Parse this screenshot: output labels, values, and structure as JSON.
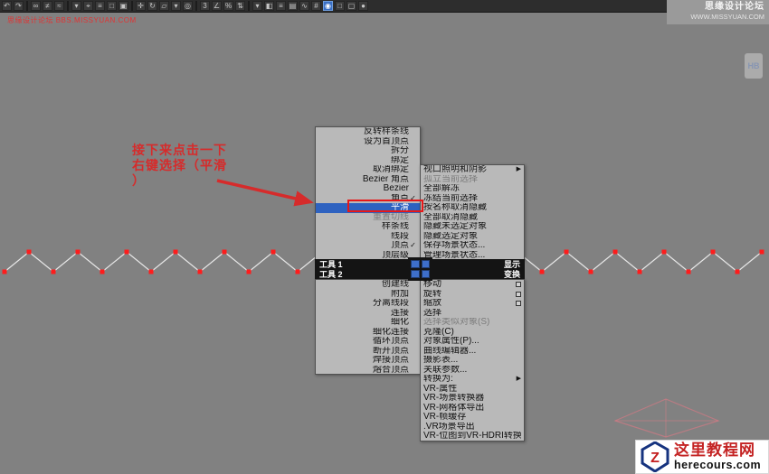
{
  "watermarks": {
    "top_right_line1": "思缘设计论坛",
    "top_right_line2": "WWW.MISSYUAN.COM",
    "top_left_red": "思缘设计论坛 BBS.MISSYUAN.COM",
    "badge": "HB"
  },
  "icons": {
    "submenu": "▶",
    "check": "✓"
  },
  "toolbar": {
    "icons": [
      {
        "name": "undo-icon",
        "glyph": "↶"
      },
      {
        "name": "redo-icon",
        "glyph": "↷"
      },
      {
        "sep": true
      },
      {
        "name": "select-and-link-icon",
        "glyph": "∞"
      },
      {
        "name": "unlink-selection-icon",
        "glyph": "≠"
      },
      {
        "name": "bind-to-spacewarp-icon",
        "glyph": "≈"
      },
      {
        "sep": true
      },
      {
        "name": "selection-filter-dropdown",
        "glyph": "▾"
      },
      {
        "name": "select-object-icon",
        "glyph": "⌖"
      },
      {
        "name": "select-by-name-icon",
        "glyph": "≡"
      },
      {
        "name": "rectangular-selection-icon",
        "glyph": "□"
      },
      {
        "name": "crossing-selection-icon",
        "glyph": "▣"
      },
      {
        "sep": true
      },
      {
        "name": "select-and-move-icon",
        "glyph": "✛"
      },
      {
        "name": "select-and-rotate-icon",
        "glyph": "↻"
      },
      {
        "name": "select-and-scale-icon",
        "glyph": "▱"
      },
      {
        "name": "reference-coordinate-dropdown",
        "glyph": "▾"
      },
      {
        "name": "use-pivot-center-icon",
        "glyph": "◎"
      },
      {
        "sep": true
      },
      {
        "name": "snap-toggle-icon",
        "glyph": "3"
      },
      {
        "name": "angle-snap-icon",
        "glyph": "∠"
      },
      {
        "name": "percent-snap-icon",
        "glyph": "%"
      },
      {
        "name": "spinner-snap-icon",
        "glyph": "⇅"
      },
      {
        "sep": true
      },
      {
        "name": "named-selection-sets-icon",
        "glyph": "▾"
      },
      {
        "name": "mirror-icon",
        "glyph": "◧"
      },
      {
        "name": "align-icon",
        "glyph": "≡"
      },
      {
        "name": "layer-manager-icon",
        "glyph": "▤"
      },
      {
        "name": "curve-editor-icon",
        "glyph": "∿"
      },
      {
        "name": "schematic-view-icon",
        "glyph": "#"
      },
      {
        "name": "material-editor-icon",
        "glyph": "◉",
        "active": true
      },
      {
        "name": "render-setup-icon",
        "glyph": "□"
      },
      {
        "name": "render-frame-icon",
        "glyph": "▢"
      },
      {
        "name": "render-icon",
        "glyph": "●"
      }
    ]
  },
  "annotation": {
    "line1": "接下来点击一下",
    "line2": "右键选择（平滑",
    "line3": "）"
  },
  "quad_menu": {
    "tools1": {
      "header": "工具 1",
      "items": [
        {
          "label": "反转样条线"
        },
        {
          "label": "设为首顶点"
        },
        {
          "label": "拆分"
        },
        {
          "label": "绑定"
        },
        {
          "label": "取消绑定"
        },
        {
          "label": "Bezier 角点"
        },
        {
          "label": "Bezier"
        },
        {
          "label": "角点",
          "checked": true
        },
        {
          "label": "平滑",
          "highlighted": true
        },
        {
          "label": "重置切线",
          "disabled": true
        },
        {
          "label": "样条线"
        },
        {
          "label": "线段"
        },
        {
          "label": "顶点",
          "checked": true
        },
        {
          "label": "顶层级"
        }
      ]
    },
    "tools2": {
      "header": "工具 2",
      "items": [
        {
          "label": "创建线"
        },
        {
          "label": "附加"
        },
        {
          "label": "分离线段"
        },
        {
          "label": "连接"
        },
        {
          "label": "细化"
        },
        {
          "label": "细化连接"
        },
        {
          "label": "循环顶点"
        },
        {
          "label": "断开顶点"
        },
        {
          "label": "焊接顶点"
        },
        {
          "label": "熔合顶点"
        }
      ]
    },
    "display": {
      "header": "显示",
      "items": [
        {
          "label": "视口照明和阴影",
          "submenu": true
        },
        {
          "label": "孤立当前选择",
          "disabled": true
        },
        {
          "label": "全部解冻"
        },
        {
          "label": "冻结当前选择"
        },
        {
          "label": "按名称取消隐藏"
        },
        {
          "label": "全部取消隐藏"
        },
        {
          "label": "隐藏未选定对象"
        },
        {
          "label": "隐藏选定对象"
        },
        {
          "label": "保存场景状态..."
        },
        {
          "label": "管理场景状态..."
        }
      ]
    },
    "transform": {
      "header": "变换",
      "items": [
        {
          "label": "移动",
          "settings": true
        },
        {
          "label": "旋转",
          "settings": true
        },
        {
          "label": "缩放",
          "settings": true
        },
        {
          "label": "选择"
        },
        {
          "label": "选择类似对象(S)",
          "disabled": true
        },
        {
          "label": "克隆(C)"
        },
        {
          "label": "对象属性(P)..."
        },
        {
          "label": "曲线编辑器..."
        },
        {
          "label": "摄影表..."
        },
        {
          "label": "关联参数..."
        },
        {
          "label": "转换为:",
          "submenu": true
        },
        {
          "label": "VR-属性"
        },
        {
          "label": "VR-场景转换器"
        },
        {
          "label": "VR-网格体导出"
        },
        {
          "label": "VR-帧缓存"
        },
        {
          "label": ".VR场景导出"
        },
        {
          "label": "VR-位图到VR-HDRI转换器"
        }
      ]
    }
  },
  "logo": {
    "letter": "Z",
    "title": "这里教程网",
    "domain": "herecours.com"
  },
  "colors": {
    "highlight_blue": "#2e62c0",
    "annotation_red": "#d62b2b",
    "vertex_red": "#ff1c1c"
  }
}
